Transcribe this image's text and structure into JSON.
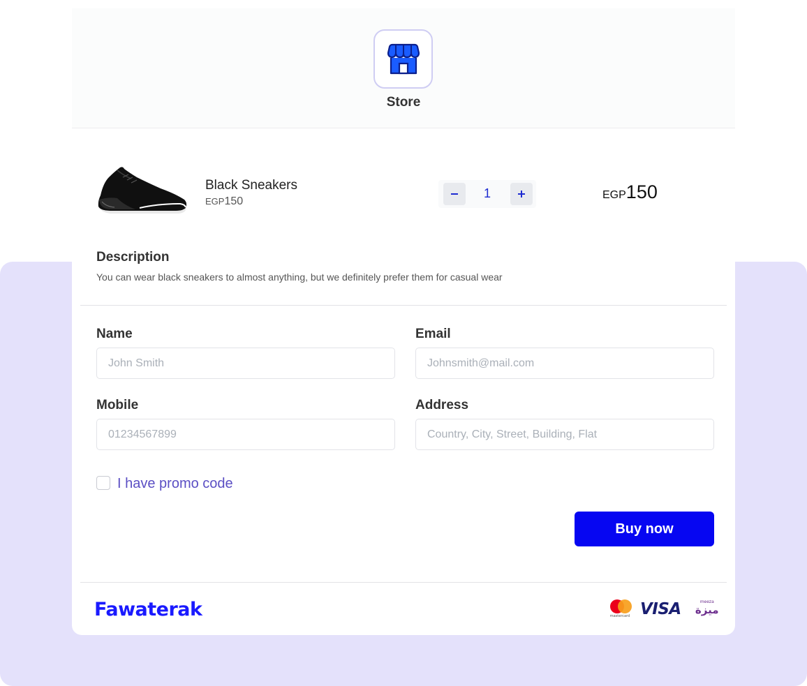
{
  "store": {
    "title": "Store",
    "icon": "store-icon"
  },
  "product": {
    "name": "Black Sneakers",
    "currency": "EGP",
    "price": "150",
    "image": "sneaker-image"
  },
  "quantity": {
    "value": "1",
    "minus_icon": "minus-icon",
    "plus_icon": "plus-icon"
  },
  "total": {
    "currency": "EGP",
    "amount": "150"
  },
  "description": {
    "title": "Description",
    "text": "You can wear black sneakers to almost anything, but we definitely prefer them for casual wear"
  },
  "form": {
    "name": {
      "label": "Name",
      "placeholder": "John Smith",
      "value": ""
    },
    "email": {
      "label": "Email",
      "placeholder": "Johnsmith@mail.com",
      "value": ""
    },
    "mobile": {
      "label": "Mobile",
      "placeholder": "01234567899",
      "value": ""
    },
    "address": {
      "label": "Address",
      "placeholder": "Country, City, Street, Building, Flat",
      "value": ""
    },
    "promo_label": "I have promo code",
    "promo_checked": false
  },
  "actions": {
    "buy_label": "Buy now"
  },
  "footer": {
    "brand": "Fawaterak",
    "payment_methods": [
      "mastercard",
      "VISA",
      "meeza"
    ]
  },
  "colors": {
    "primary": "#0606f2",
    "accent_purple": "#5b4fc4",
    "background_panel": "#e4e1fb",
    "icon_blue": "#1a5cff"
  }
}
